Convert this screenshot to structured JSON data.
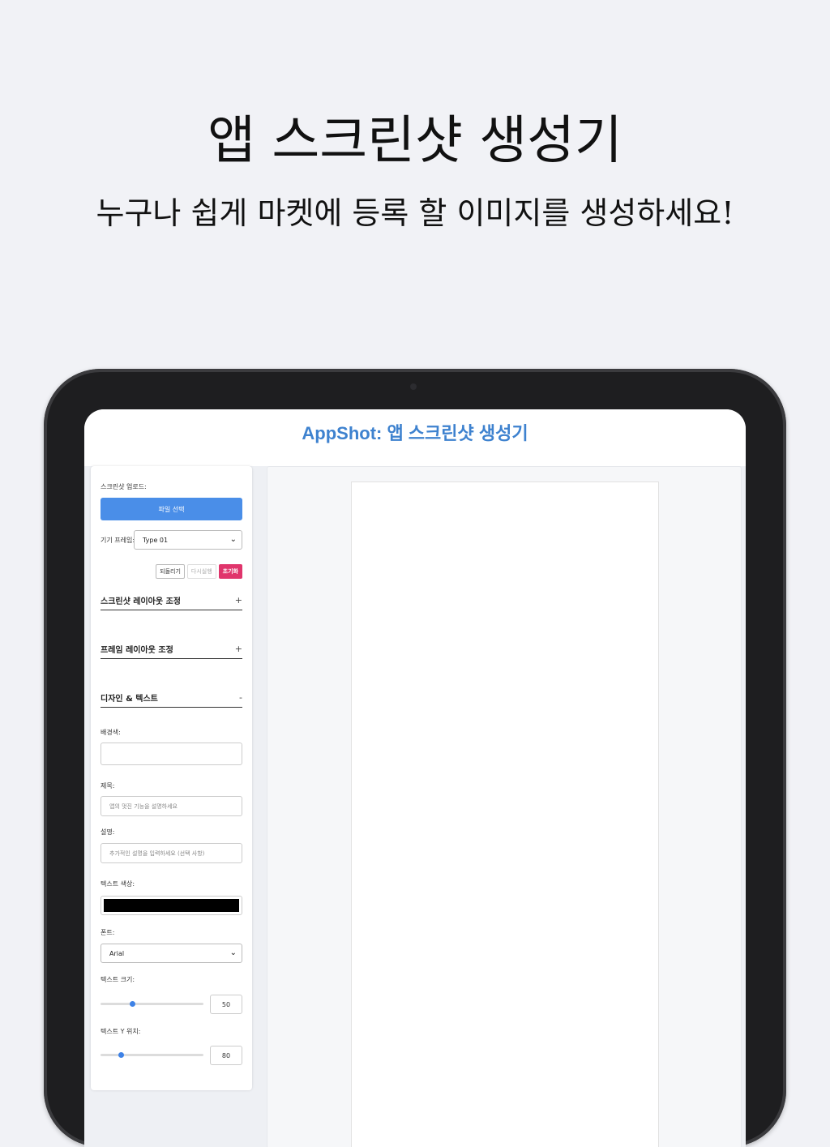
{
  "hero": {
    "title": "앱 스크린샷 생성기",
    "subtitle": "누구나 쉽게 마켓에 등록 할 이미지를 생성하세요!"
  },
  "app": {
    "title": "AppShot: 앱 스크린샷 생성기",
    "accent_color": "#3e82cf"
  },
  "panel": {
    "upload_label": "스크린샷 업로드:",
    "upload_button": "파일 선택",
    "device_frame_label": "기기 프레임:",
    "device_frame_value": "Type 01",
    "undo": "되돌리기",
    "redo": "다시실행",
    "reset": "초기화",
    "reset_color": "#e0356c",
    "sections": {
      "screenshot_layout": {
        "title": "스크린샷 레이아웃 조정",
        "toggle": "+"
      },
      "frame_layout": {
        "title": "프레임 레이아웃 조정",
        "toggle": "+"
      },
      "design_text": {
        "title": "디자인 & 텍스트",
        "toggle": "-"
      }
    },
    "background_color_label": "배경색:",
    "title_label": "제목:",
    "title_placeholder": "앱의 멋진 기능을 설명하세요",
    "description_label": "설명:",
    "description_placeholder": "추가적인 설명을 입력하세요 (선택 사항)",
    "text_color_label": "텍스트 색상:",
    "text_color_value": "#000000",
    "font_label": "폰트:",
    "font_value": "Arial",
    "text_size_label": "텍스트 크기:",
    "text_size_value": "50",
    "text_size_fraction": 0.3,
    "text_y_label": "텍스트 Y 위치:",
    "text_y_value": "80",
    "text_y_fraction": 0.18
  }
}
